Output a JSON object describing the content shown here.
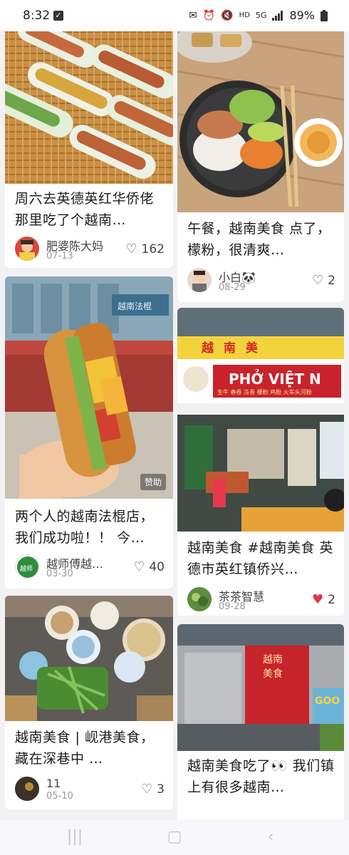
{
  "status_bar": {
    "time": "8:32",
    "network": "5G",
    "hd": "HD",
    "battery": "89%",
    "icons": [
      "checkbox-icon",
      "chat-icon",
      "alarm-icon",
      "mute-icon",
      "hd-icon",
      "signal-icon",
      "battery-icon"
    ]
  },
  "feed": {
    "left": [
      {
        "title": "周六去英德英红华侨佬那里吃了个越南…",
        "author": "肥婆陈大妈",
        "date": "07-13",
        "likes": "162",
        "liked": false
      },
      {
        "title": "两个人的越南法棍店，我们成功啦！！ 今…",
        "author": "越师傅越…",
        "date": "03-30",
        "likes": "40",
        "liked": false,
        "sponsor": "赞助"
      },
      {
        "title": "越南美食 | 岘港美食，藏在深巷中 …",
        "author": "11",
        "date": "05-10",
        "likes": "3",
        "liked": false
      }
    ],
    "right": [
      {
        "title": "午餐，越南美食 点了，檬粉，很清爽…",
        "author": "小白🐼",
        "date": "08-29",
        "likes": "2",
        "liked": false
      },
      {
        "title": "越南美食 #越南美食 英德市英红镇侨兴…",
        "author": "茶茶智慧",
        "date": "09-28",
        "likes": "2",
        "liked": true,
        "sign_top": "越  南  美",
        "sign_main": "PHỞ VIỆT N",
        "sign_sub": "生牛 春卷 冻卷 檬粉 鸡粉 火车头河粉"
      },
      {
        "title": "越南美食吃了👀 我们镇上有很多越南…",
        "sign_main": "越南美食",
        "sign_side": "GOO"
      }
    ]
  },
  "colors": {
    "like_active": "#e8324a",
    "text": "#1c1c1c",
    "muted": "#9a9a9a"
  },
  "nav": {
    "icons": [
      "recent-apps-icon",
      "home-icon",
      "back-icon"
    ]
  }
}
